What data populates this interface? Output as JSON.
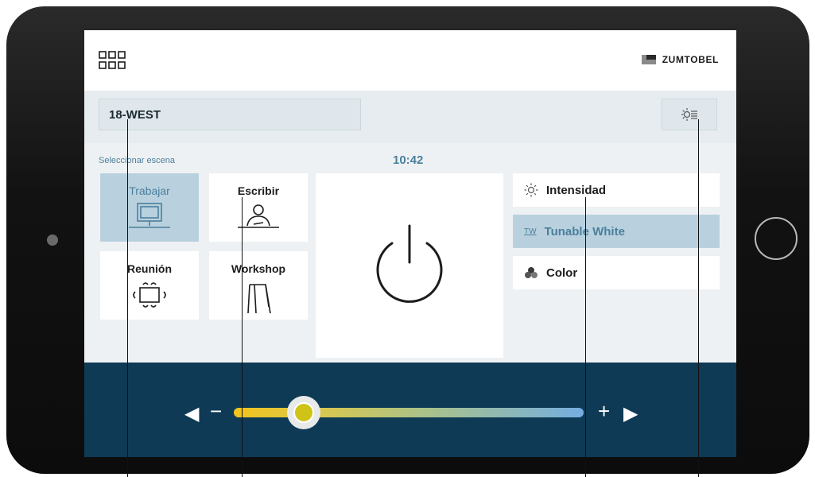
{
  "header": {
    "brand_name": "ZUMTOBEL"
  },
  "room": {
    "name": "18-WEST"
  },
  "scenes": {
    "label": "Seleccionar escena",
    "items": [
      {
        "label": "Trabajar",
        "icon": "monitor-icon",
        "active": true
      },
      {
        "label": "Escribir",
        "icon": "writing-person-icon",
        "active": false
      },
      {
        "label": "Reunión",
        "icon": "meeting-table-icon",
        "active": false
      },
      {
        "label": "Workshop",
        "icon": "flipchart-icon",
        "active": false
      }
    ]
  },
  "clock": "10:42",
  "options": [
    {
      "label": "Intensidad",
      "icon": "sun-icon",
      "active": false
    },
    {
      "label": "Tunable White",
      "icon": "tw-icon",
      "icon_text": "TW",
      "active": true
    },
    {
      "label": "Color",
      "icon": "color-dots-icon",
      "active": false
    }
  ],
  "slider": {
    "minus": "−",
    "plus": "+",
    "value_fraction": 0.2
  },
  "colors": {
    "accent": "#4b7f9c",
    "active_tile": "#b9d1de",
    "bottom_bar": "#0e3a56",
    "slider_start": "#f2c51b",
    "slider_end": "#74aee0"
  }
}
